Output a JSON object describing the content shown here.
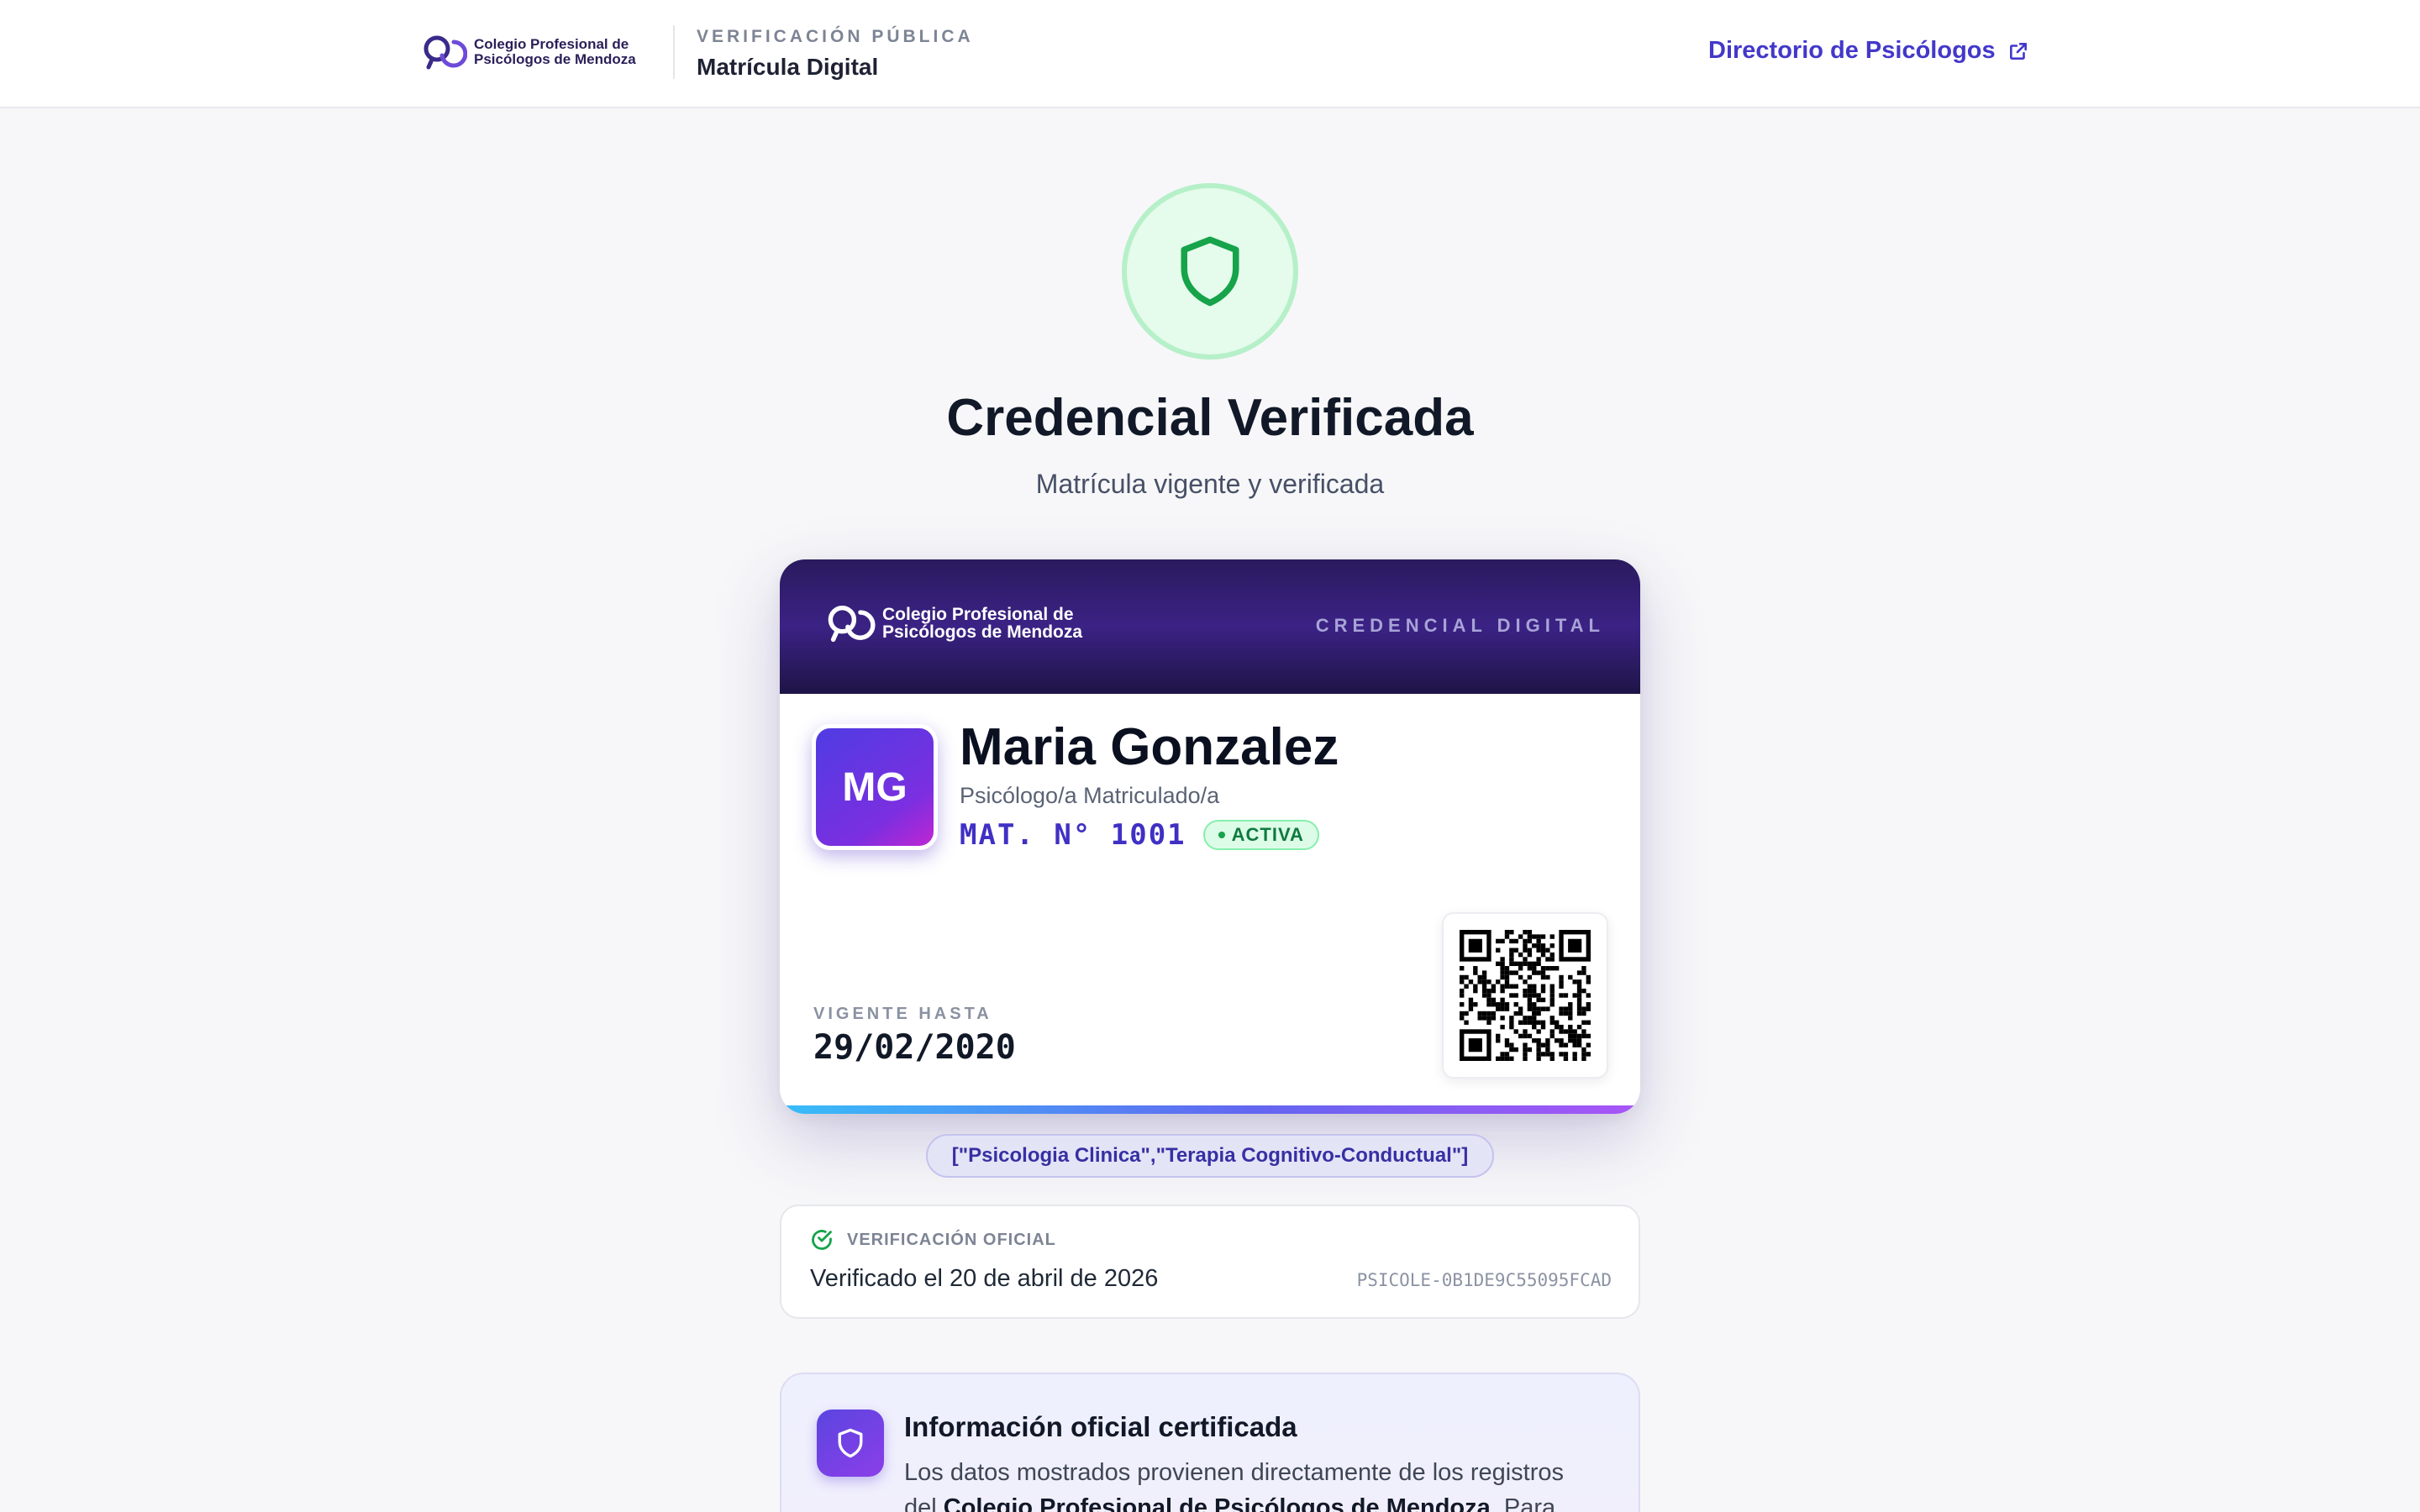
{
  "header": {
    "brand_line1": "Colegio Profesional de",
    "brand_line2": "Psicólogos de Mendoza",
    "kicker": "VERIFICACIÓN PÚBLICA",
    "title": "Matrícula Digital",
    "directory_link": "Directorio de Psicólogos",
    "directory_icon": "external-link-icon"
  },
  "hero": {
    "icon": "shield-icon",
    "title": "Credencial Verificada",
    "subtitle": "Matrícula vigente y verificada"
  },
  "card": {
    "org_line1": "Colegio Profesional de",
    "org_line2": "Psicólogos de Mendoza",
    "label": "CREDENCIAL DIGITAL",
    "initials": "MG",
    "name": "Maria Gonzalez",
    "role": "Psicólogo/a Matriculado/a",
    "matricula": "MAT. N° 1001",
    "status": "ACTIVA",
    "valid_label": "VIGENTE HASTA",
    "valid_until": "29/02/2020",
    "qr_icon": "qr-code-icon"
  },
  "specialties": "[\"Psicologia Clinica\",\"Terapia Cognitivo-Conductual\"]",
  "verification": {
    "icon": "check-circle-icon",
    "label": "VERIFICACIÓN OFICIAL",
    "date_text": "Verificado el 20 de abril de 2026",
    "code": "PSICOLE-0B1DE9C55095FCAD"
  },
  "info": {
    "icon": "shield-icon",
    "title": "Información oficial certificada",
    "text_before": "Los datos mostrados provienen directamente de los registros del ",
    "text_bold": "Colegio Profesional de Psicólogos de Mendoza",
    "text_after": ". Para"
  },
  "colors": {
    "accent": "#4338ca",
    "success": "#16a34a",
    "card_header": "#2a1a5e"
  }
}
